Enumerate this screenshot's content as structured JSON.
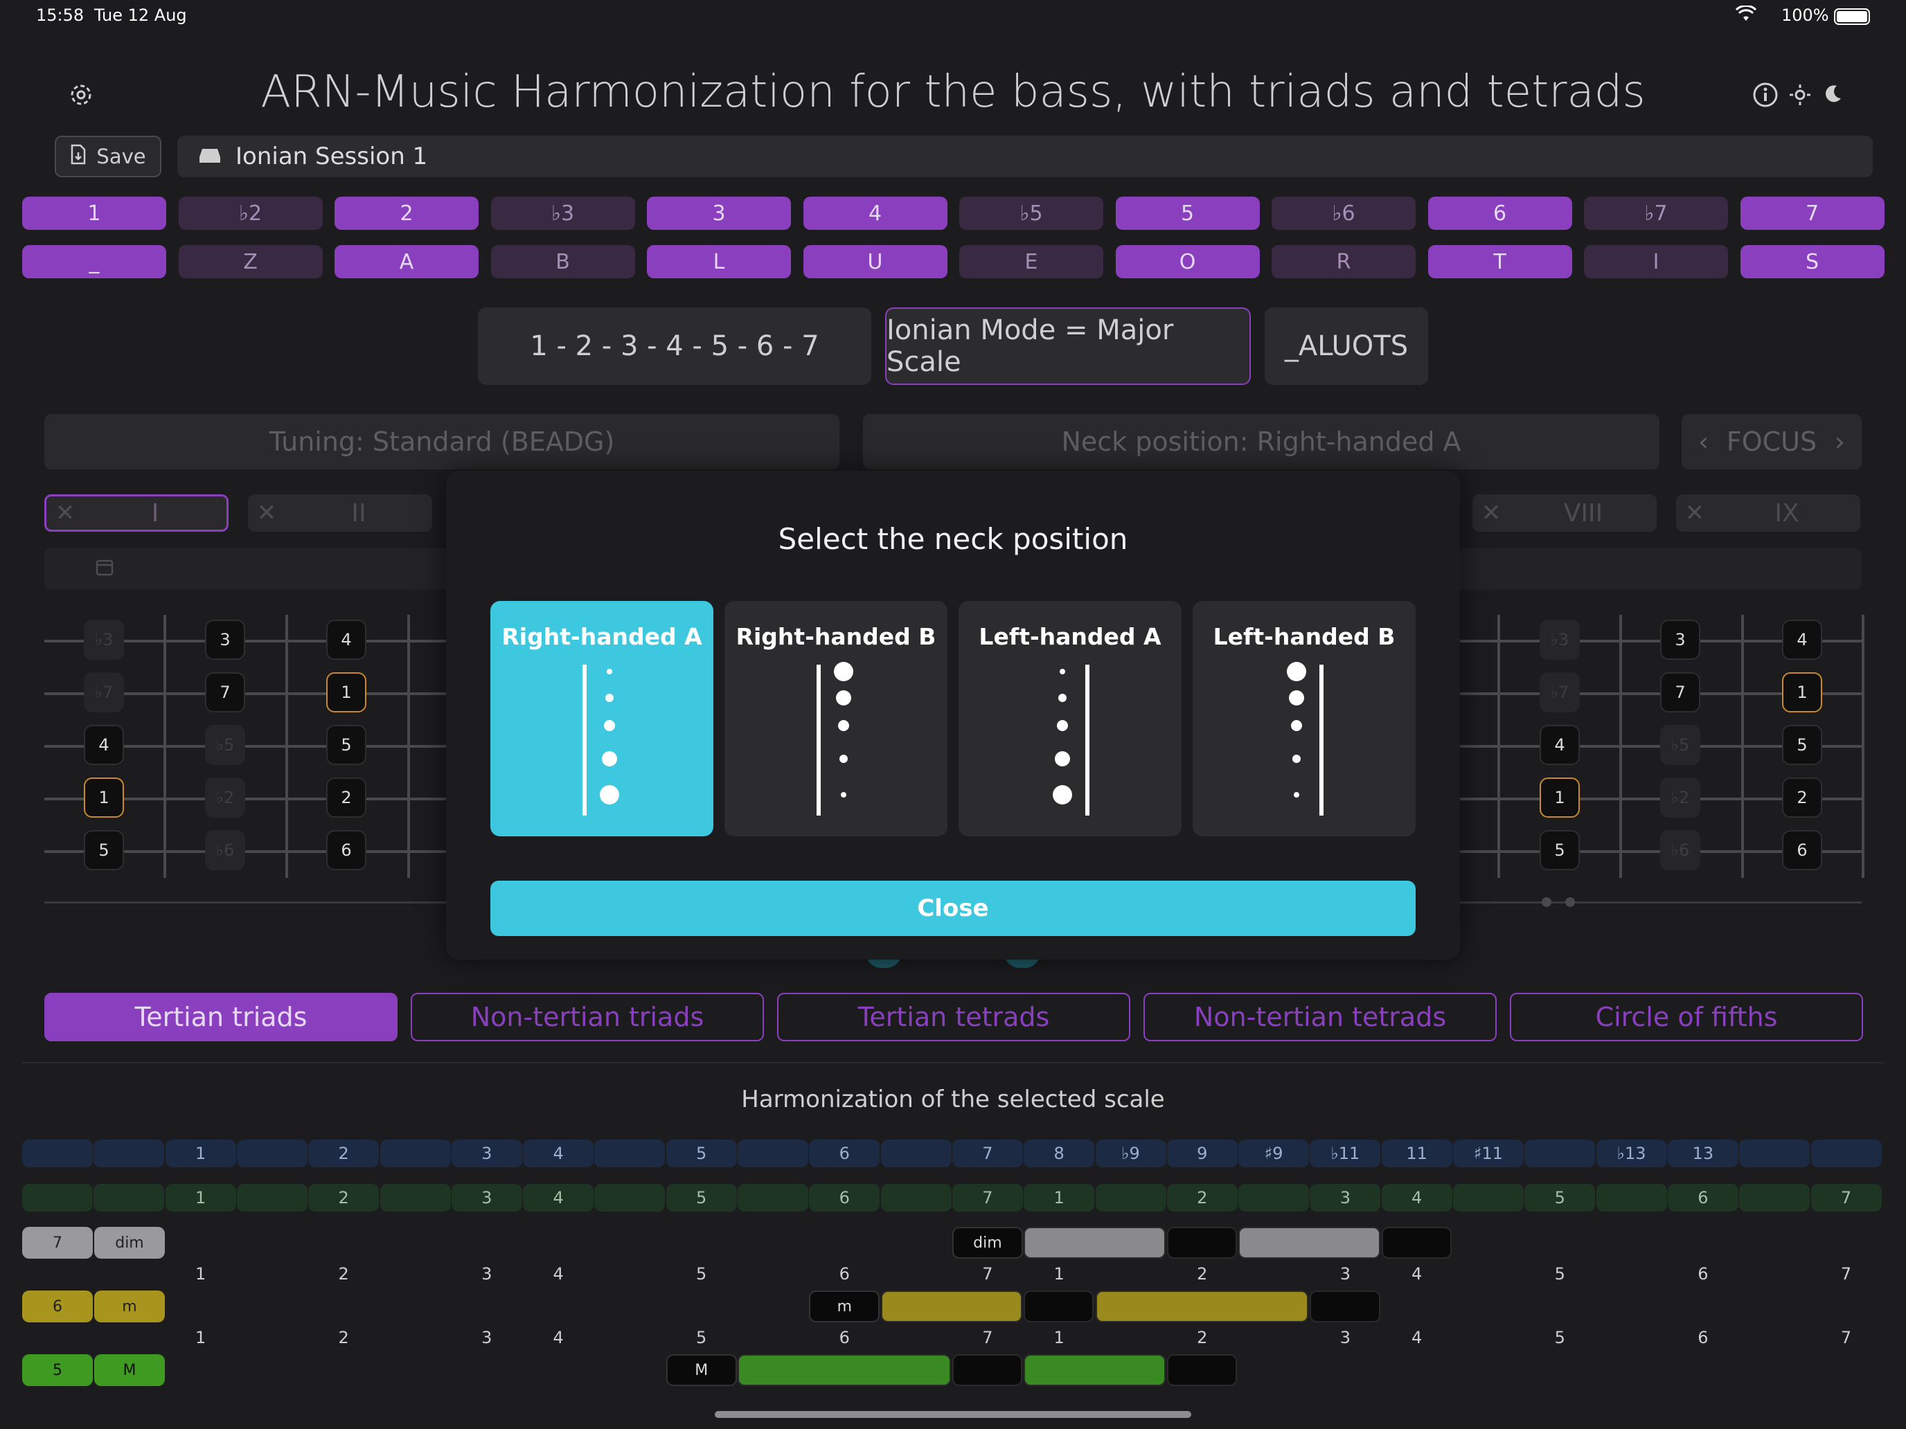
{
  "status_bar": {
    "time": "15:58",
    "date": "Tue 12 Aug",
    "battery": "100%"
  },
  "header": {
    "title": "ARN-Music   Harmonization for the bass, with triads and tetrads"
  },
  "toolbar": {
    "save_label": "Save",
    "session_name": "Ionian Session 1"
  },
  "degrees_row": [
    {
      "label": "1",
      "on": true
    },
    {
      "label": "♭2",
      "on": false
    },
    {
      "label": "2",
      "on": true
    },
    {
      "label": "♭3",
      "on": false
    },
    {
      "label": "3",
      "on": true
    },
    {
      "label": "4",
      "on": true
    },
    {
      "label": "♭5",
      "on": false
    },
    {
      "label": "5",
      "on": true
    },
    {
      "label": "♭6",
      "on": false
    },
    {
      "label": "6",
      "on": true
    },
    {
      "label": "♭7",
      "on": false
    },
    {
      "label": "7",
      "on": true
    }
  ],
  "letters_row": [
    "_",
    "Z",
    "A",
    "B",
    "L",
    "U",
    "E",
    "O",
    "R",
    "T",
    "I",
    "S"
  ],
  "scale_info": {
    "formula": "1 - 2 - 3 - 4 - 5 - 6 - 7",
    "mode": "Ionian Mode = Major Scale",
    "code": "_ALUOTS"
  },
  "settings_bars": {
    "tuning": "Tuning: Standard (BEADG)",
    "neck": "Neck position: Right-handed A",
    "focus": "FOCUS"
  },
  "positions": {
    "left": [
      "I",
      "II"
    ],
    "right": [
      "VIII",
      "IX"
    ]
  },
  "fretboard_left": [
    {
      "col": 0,
      "s": 0,
      "t": "♭3",
      "g": true
    },
    {
      "col": 0,
      "s": 1,
      "t": "♭7",
      "g": true
    },
    {
      "col": 0,
      "s": 2,
      "t": "4"
    },
    {
      "col": 0,
      "s": 3,
      "t": "1",
      "r": true
    },
    {
      "col": 0,
      "s": 4,
      "t": "5"
    },
    {
      "col": 1,
      "s": 0,
      "t": "3"
    },
    {
      "col": 1,
      "s": 1,
      "t": "7"
    },
    {
      "col": 1,
      "s": 2,
      "t": "♭5",
      "g": true
    },
    {
      "col": 1,
      "s": 3,
      "t": "♭2",
      "g": true
    },
    {
      "col": 1,
      "s": 4,
      "t": "♭6",
      "g": true
    },
    {
      "col": 2,
      "s": 0,
      "t": "4"
    },
    {
      "col": 2,
      "s": 1,
      "t": "1",
      "r": true
    },
    {
      "col": 2,
      "s": 2,
      "t": "5"
    },
    {
      "col": 2,
      "s": 3,
      "t": "2"
    },
    {
      "col": 2,
      "s": 4,
      "t": "6"
    }
  ],
  "fretboard_right": [
    {
      "col": 0,
      "s": 0,
      "t": "♭3",
      "g": true
    },
    {
      "col": 0,
      "s": 1,
      "t": "♭7",
      "g": true
    },
    {
      "col": 0,
      "s": 2,
      "t": "4"
    },
    {
      "col": 0,
      "s": 3,
      "t": "1",
      "r": true
    },
    {
      "col": 0,
      "s": 4,
      "t": "5"
    },
    {
      "col": 1,
      "s": 0,
      "t": "3"
    },
    {
      "col": 1,
      "s": 1,
      "t": "7"
    },
    {
      "col": 1,
      "s": 2,
      "t": "♭5",
      "g": true
    },
    {
      "col": 1,
      "s": 3,
      "t": "♭2",
      "g": true
    },
    {
      "col": 1,
      "s": 4,
      "t": "♭6",
      "g": true
    },
    {
      "col": 2,
      "s": 0,
      "t": "4"
    },
    {
      "col": 2,
      "s": 1,
      "t": "1",
      "r": true
    },
    {
      "col": 2,
      "s": 2,
      "t": "5"
    },
    {
      "col": 2,
      "s": 3,
      "t": "2"
    },
    {
      "col": 2,
      "s": 4,
      "t": "6"
    }
  ],
  "categories": [
    {
      "label": "Tertian triads",
      "on": true
    },
    {
      "label": "Non-tertian triads",
      "on": false
    },
    {
      "label": "Tertian tetrads",
      "on": false
    },
    {
      "label": "Non-tertian tetrads",
      "on": false
    },
    {
      "label": "Circle of fifths",
      "on": false
    }
  ],
  "harmonization": {
    "title": "Harmonization of the selected scale",
    "blue_row": [
      "",
      "",
      "1",
      "",
      "2",
      "",
      "3",
      "4",
      "",
      "5",
      "",
      "6",
      "",
      "7",
      "8",
      "♭9",
      "9",
      "♯9",
      "♭11",
      "11",
      "♯11",
      "",
      "♭13",
      "13",
      "",
      ""
    ],
    "green_row": [
      "",
      "",
      "1",
      "",
      "2",
      "",
      "3",
      "4",
      "",
      "5",
      "",
      "6",
      "",
      "7",
      "1",
      "",
      "2",
      "",
      "3",
      "4",
      "",
      "5",
      "",
      "6",
      "",
      "7"
    ],
    "number_labels": [
      "1",
      "2",
      "3",
      "4",
      "5",
      "6",
      "7",
      "1",
      "2",
      "3",
      "4",
      "5",
      "6",
      "7"
    ],
    "chords": [
      {
        "degree": "7",
        "quality": "dim",
        "tag": "dim",
        "tag_col": 13,
        "segments": [
          [
            14,
            2,
            "#8a8a8c"
          ],
          [
            16,
            1,
            "#0a0a0a"
          ],
          [
            17,
            2,
            "#8a8a8c"
          ],
          [
            19,
            1,
            "#0a0a0a"
          ]
        ],
        "color": "#9a9a9c",
        "text": "#222"
      },
      {
        "degree": "6",
        "quality": "m",
        "tag": "m",
        "tag_col": 11,
        "segments": [
          [
            12,
            2,
            "#9a8a1e"
          ],
          [
            14,
            1,
            "#0a0a0a"
          ],
          [
            15,
            3,
            "#9a8a1e"
          ],
          [
            18,
            1,
            "#0a0a0a"
          ]
        ],
        "color": "#a8951e",
        "text": "#222"
      },
      {
        "degree": "5",
        "quality": "M",
        "tag": "M",
        "tag_col": 9,
        "segments": [
          [
            10,
            3,
            "#3a8a24"
          ],
          [
            13,
            1,
            "#0a0a0a"
          ],
          [
            14,
            2,
            "#3a8a24"
          ],
          [
            16,
            1,
            "#0a0a0a"
          ]
        ],
        "color": "#3f9a22",
        "text": "#111"
      }
    ]
  },
  "modal": {
    "title": "Select the neck position",
    "options": [
      {
        "label": "Right-handed A",
        "selected": true,
        "side": "right",
        "dots": "small-to-large"
      },
      {
        "label": "Right-handed B",
        "selected": false,
        "side": "right",
        "dots": "large-to-small"
      },
      {
        "label": "Left-handed A",
        "selected": false,
        "side": "left",
        "dots": "small-to-large"
      },
      {
        "label": "Left-handed B",
        "selected": false,
        "side": "left",
        "dots": "large-to-small"
      }
    ],
    "close_label": "Close"
  },
  "colors": {
    "accent_purple": "#8a3fbe",
    "accent_cyan": "#3ec8e0",
    "root_orange": "#c98a2a"
  }
}
